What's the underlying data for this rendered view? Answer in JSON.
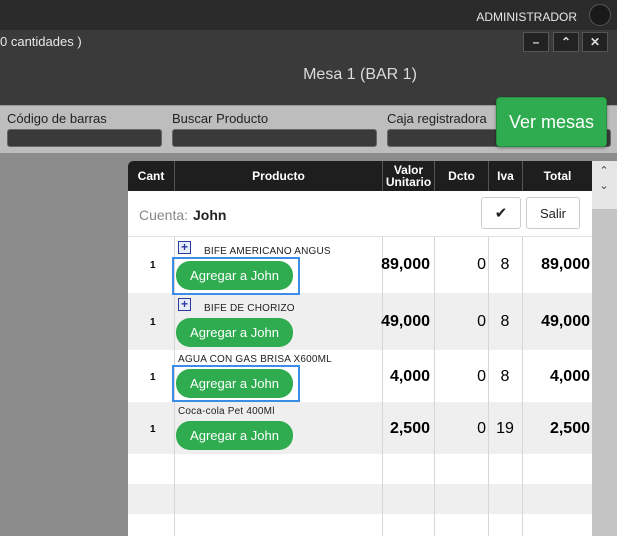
{
  "topbar": {
    "admin_label": "ADMINISTRADOR"
  },
  "header": {
    "qty_text": "0 cantidades )",
    "title": "Mesa 1 (BAR 1)",
    "window_buttons": [
      "–",
      "⌃",
      "✕"
    ]
  },
  "filters": {
    "barcode_label": "Código de barras",
    "search_label": "Buscar Producto",
    "register_label": "Caja registradora",
    "ver_mesas_label": "Ver mesas"
  },
  "table": {
    "headers": {
      "cant": "Cant",
      "producto": "Producto",
      "valor_unitario": "Valor Unitario",
      "dcto": "Dcto",
      "iva": "Iva",
      "total": "Total"
    }
  },
  "cuenta": {
    "label": "Cuenta:",
    "name": "John",
    "check_icon": "check-icon",
    "salir_label": "Salir"
  },
  "rows": [
    {
      "cant": "1",
      "name": "BIFE AMERICANO ANGUS",
      "has_plus": true,
      "button": "Agregar a John",
      "valor": "89,000",
      "dcto": "0",
      "iva": "8",
      "total": "89,000"
    },
    {
      "cant": "1",
      "name": "BIFE DE CHORIZO",
      "has_plus": true,
      "button": "Agregar a John",
      "valor": "49,000",
      "dcto": "0",
      "iva": "8",
      "total": "49,000"
    },
    {
      "cant": "1",
      "name": "AGUA CON GAS BRISA X600ML",
      "has_plus": false,
      "button": "Agregar a John",
      "valor": "4,000",
      "dcto": "0",
      "iva": "8",
      "total": "4,000"
    },
    {
      "cant": "1",
      "name": "Coca-cola Pet 400Ml",
      "has_plus": false,
      "button": "Agregar a John",
      "valor": "2,500",
      "dcto": "0",
      "iva": "19",
      "total": "2,500"
    }
  ]
}
